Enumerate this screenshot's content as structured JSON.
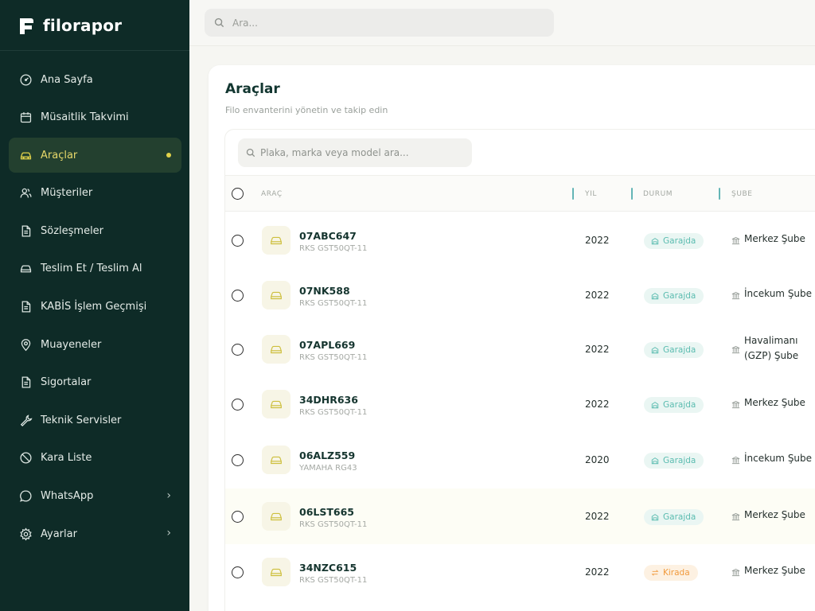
{
  "app": {
    "name": "filorapor"
  },
  "sidebar": {
    "items": [
      {
        "label": "Ana Sayfa",
        "icon": "dashboard-icon"
      },
      {
        "label": "Müsaitlik Takvimi",
        "icon": "calendar-icon"
      },
      {
        "label": "Araçlar",
        "icon": "car-icon",
        "active": true
      },
      {
        "label": "Müşteriler",
        "icon": "users-icon"
      },
      {
        "label": "Sözleşmeler",
        "icon": "document-icon"
      },
      {
        "label": "Teslim Et / Teslim Al",
        "icon": "car-icon"
      },
      {
        "label": "KABİS İşlem Geçmişi",
        "icon": "document-icon"
      },
      {
        "label": "Muayeneler",
        "icon": "location-pin-icon"
      },
      {
        "label": "Sigortalar",
        "icon": "document-icon"
      },
      {
        "label": "Teknik Servisler",
        "icon": "wrench-icon"
      },
      {
        "label": "Kara Liste",
        "icon": "ban-icon"
      },
      {
        "label": "WhatsApp",
        "icon": "chat-icon",
        "has_submenu": true
      },
      {
        "label": "Ayarlar",
        "icon": "gear-icon",
        "has_submenu": true
      }
    ]
  },
  "topbar": {
    "search_placeholder": "Ara..."
  },
  "page": {
    "title": "Araçlar",
    "subtitle": "Filo envanterini yönetin ve takip edin"
  },
  "table": {
    "search_placeholder": "Plaka, marka veya model ara...",
    "columns": {
      "vehicle": "ARAÇ",
      "year": "YIL",
      "status": "DURUM",
      "branch": "ŞUBE"
    },
    "rows": [
      {
        "plate": "07ABC647",
        "model": "RKS GST50QT-11",
        "year": "2022",
        "status": "Garajda",
        "branch_line1": "Merkez Şube",
        "branch_line2": ""
      },
      {
        "plate": "07NK588",
        "model": "RKS GST50QT-11",
        "year": "2022",
        "status": "Garajda",
        "branch_line1": "İncekum Şube",
        "branch_line2": ""
      },
      {
        "plate": "07APL669",
        "model": "RKS GST50QT-11",
        "year": "2022",
        "status": "Garajda",
        "branch_line1": "Havalimanı",
        "branch_line2": "(GZP) Şube"
      },
      {
        "plate": "34DHR636",
        "model": "RKS GST50QT-11",
        "year": "2022",
        "status": "Garajda",
        "branch_line1": "Merkez Şube",
        "branch_line2": ""
      },
      {
        "plate": "06ALZ559",
        "model": "YAMAHA RG43",
        "year": "2020",
        "status": "Garajda",
        "branch_line1": "İncekum Şube",
        "branch_line2": ""
      },
      {
        "plate": "06LST665",
        "model": "RKS GST50QT-11",
        "year": "2022",
        "status": "Garajda",
        "branch_line1": "Merkez Şube",
        "branch_line2": ""
      },
      {
        "plate": "34NZC615",
        "model": "RKS GST50QT-11",
        "year": "2022",
        "status": "Kirada",
        "branch_line1": "Merkez Şube",
        "branch_line2": ""
      }
    ]
  },
  "colors": {
    "sidebar_bg": "#0e2b27",
    "active_accent": "#e2d24a",
    "status_garage": "#5bbcb0",
    "status_rented": "#f19a3c"
  }
}
